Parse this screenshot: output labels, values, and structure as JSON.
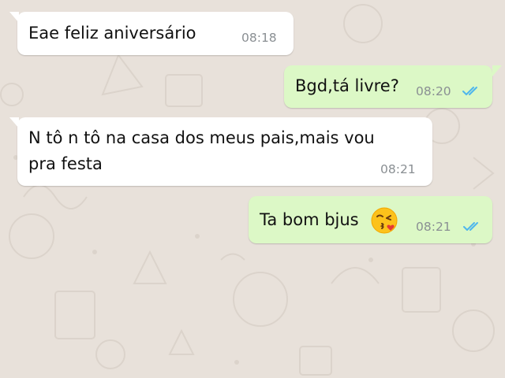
{
  "messages": [
    {
      "direction": "incoming",
      "text": "Eae feliz aniversário",
      "time": "08:18"
    },
    {
      "direction": "outgoing",
      "text": "Bgd,tá livre?",
      "time": "08:20",
      "status": "read"
    },
    {
      "direction": "incoming",
      "line1": "N tô n tô na casa dos meus pais,mais vou",
      "line2": "pra festa",
      "time": "08:21"
    },
    {
      "direction": "outgoing",
      "text": "Ta bom bjus",
      "emoji": "kissing-face-emoji",
      "time": "08:21",
      "status": "read"
    }
  ],
  "colors": {
    "incoming_bubble": "#ffffff",
    "outgoing_bubble": "#dcf8c6",
    "read_ticks": "#4fb6ec",
    "timestamp": "#8a8f93",
    "wallpaper": "#e8e1da"
  }
}
